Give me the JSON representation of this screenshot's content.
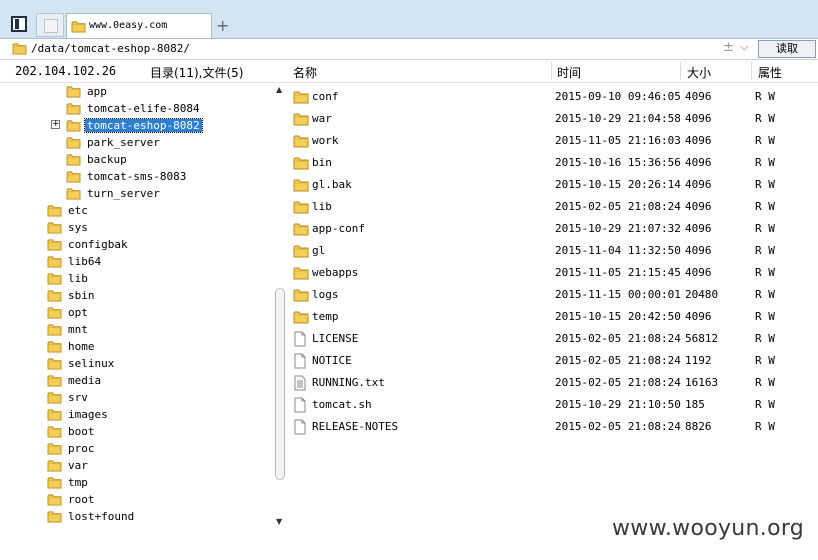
{
  "tabs": {
    "active_title": "www.0easy.com",
    "new_tab_symbol": "+"
  },
  "address": {
    "path": "/data/tomcat-eshop-8082/",
    "plus_minus": "±",
    "dropdown_symbol": "⌵",
    "read_button": "读取"
  },
  "header": {
    "ip": "202.104.102.26",
    "summary": "目录(11),文件(5)",
    "col_name": "名称",
    "col_time": "时间",
    "col_size": "大小",
    "col_attr": "属性"
  },
  "tree": {
    "sub_items": [
      {
        "label": "app",
        "selected": false
      },
      {
        "label": "tomcat-elife-8084",
        "selected": false
      },
      {
        "label": "tomcat-eshop-8082",
        "selected": true
      },
      {
        "label": "park_server",
        "selected": false
      },
      {
        "label": "backup",
        "selected": false
      },
      {
        "label": "tomcat-sms-8083",
        "selected": false
      },
      {
        "label": "turn_server",
        "selected": false
      }
    ],
    "root_items": [
      "etc",
      "sys",
      "configbak",
      "lib64",
      "lib",
      "sbin",
      "opt",
      "mnt",
      "home",
      "selinux",
      "media",
      "srv",
      "images",
      "boot",
      "proc",
      "var",
      "tmp",
      "root",
      "lost+found"
    ],
    "expand_symbol": "+",
    "scroll_up": "▲",
    "scroll_down": "▼"
  },
  "files": [
    {
      "name": "conf",
      "type": "folder",
      "time": "2015-09-10 09:46:05",
      "size": "4096",
      "attr": "R W"
    },
    {
      "name": "war",
      "type": "folder",
      "time": "2015-10-29 21:04:58",
      "size": "4096",
      "attr": "R W"
    },
    {
      "name": "work",
      "type": "folder",
      "time": "2015-11-05 21:16:03",
      "size": "4096",
      "attr": "R W"
    },
    {
      "name": "bin",
      "type": "folder",
      "time": "2015-10-16 15:36:56",
      "size": "4096",
      "attr": "R W"
    },
    {
      "name": "gl.bak",
      "type": "folder",
      "time": "2015-10-15 20:26:14",
      "size": "4096",
      "attr": "R W"
    },
    {
      "name": "lib",
      "type": "folder",
      "time": "2015-02-05 21:08:24",
      "size": "4096",
      "attr": "R W"
    },
    {
      "name": "app-conf",
      "type": "folder",
      "time": "2015-10-29 21:07:32",
      "size": "4096",
      "attr": "R W"
    },
    {
      "name": "gl",
      "type": "folder",
      "time": "2015-11-04 11:32:50",
      "size": "4096",
      "attr": "R W"
    },
    {
      "name": "webapps",
      "type": "folder",
      "time": "2015-11-05 21:15:45",
      "size": "4096",
      "attr": "R W"
    },
    {
      "name": "logs",
      "type": "folder",
      "time": "2015-11-15 00:00:01",
      "size": "20480",
      "attr": "R W"
    },
    {
      "name": "temp",
      "type": "folder",
      "time": "2015-10-15 20:42:50",
      "size": "4096",
      "attr": "R W"
    },
    {
      "name": "LICENSE",
      "type": "file",
      "time": "2015-02-05 21:08:24",
      "size": "56812",
      "attr": "R W"
    },
    {
      "name": "NOTICE",
      "type": "file",
      "time": "2015-02-05 21:08:24",
      "size": "1192",
      "attr": "R W"
    },
    {
      "name": "RUNNING.txt",
      "type": "textfile",
      "time": "2015-02-05 21:08:24",
      "size": "16163",
      "attr": "R W"
    },
    {
      "name": "tomcat.sh",
      "type": "file",
      "time": "2015-10-29 21:10:50",
      "size": "185",
      "attr": "R W"
    },
    {
      "name": "RELEASE-NOTES",
      "type": "file",
      "time": "2015-02-05 21:08:24",
      "size": "8826",
      "attr": "R W"
    }
  ],
  "watermark": "www.wooyun.org",
  "colors": {
    "folder_fill": "#f3cf5a",
    "folder_stroke": "#b8891c",
    "selection": "#2f7fd0",
    "tabbar_bg": "#d3e4f2"
  },
  "icons": {
    "folder": "folder-icon",
    "file": "file-icon",
    "textfile": "text-file-icon"
  }
}
